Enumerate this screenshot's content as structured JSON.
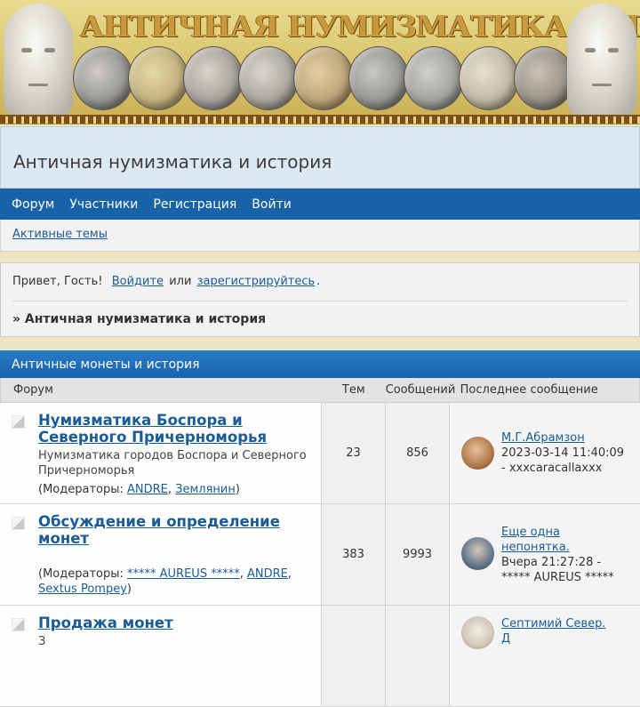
{
  "banner": {
    "title": "АНТИЧНАЯ НУМИЗМАТИКА И ИСТОРИЯ",
    "coin_colors": [
      "#8a8a86",
      "#b8a774",
      "#9c9690",
      "#a09a92",
      "#b39a6f",
      "#8d8b87",
      "#999792",
      "#b8ae9a",
      "#8c867c"
    ]
  },
  "header": {
    "site_title": "Античная нумизматика и история"
  },
  "nav": {
    "items": [
      "Форум",
      "Участники",
      "Регистрация",
      "Войти"
    ]
  },
  "subnav": {
    "active_topics": "Активные темы"
  },
  "welcome": {
    "greeting": "Привет, Гость!",
    "login": "Войдите",
    "or": "или",
    "register": "зарегистрируйтесь",
    "period": "."
  },
  "breadcrumb": {
    "text": "» Античная нумизматика и история"
  },
  "category": {
    "title": "Античные монеты и история",
    "columns": {
      "forum": "Форум",
      "topics": "Тем",
      "posts": "Сообщений",
      "last": "Последнее сообщение"
    },
    "boards": [
      {
        "title_line1": "Нумизматика Боспора и",
        "title_line2": "Северного Причерноморья",
        "description": "Нумизматика городов Боспора и Северного Причерноморья",
        "mods_prefix": "(Модераторы:",
        "mods": [
          "ANDRE",
          "Землянин"
        ],
        "topics": "23",
        "posts": "856",
        "last_title": "М.Г.Абрамзон",
        "last_time": "2023-03-14 11:40:09",
        "last_author": "- xxxcaracallaxxx"
      },
      {
        "title_line1": "Обсуждение и определение",
        "title_line2": "монет",
        "description": "",
        "mods_prefix": "(Модераторы:",
        "mods": [
          "***** AUREUS *****",
          "ANDRE",
          "Sextus Pompey"
        ],
        "topics": "383",
        "posts": "9993",
        "last_title_line1": "Еще одна",
        "last_title_line2": "непонятка.",
        "last_time": "Вчера 21:27:28 -",
        "last_author": "***** AUREUS *****"
      },
      {
        "title_line1": "Продажа монет",
        "description_partial": "З",
        "last_title_line1": "Септимий Север.",
        "last_title_line2": "Д"
      }
    ]
  },
  "colors": {
    "nav": "#1862a8",
    "link": "#1a5c96",
    "header_bg": "#dbe9f5",
    "page_bg": "#ece6c4"
  }
}
